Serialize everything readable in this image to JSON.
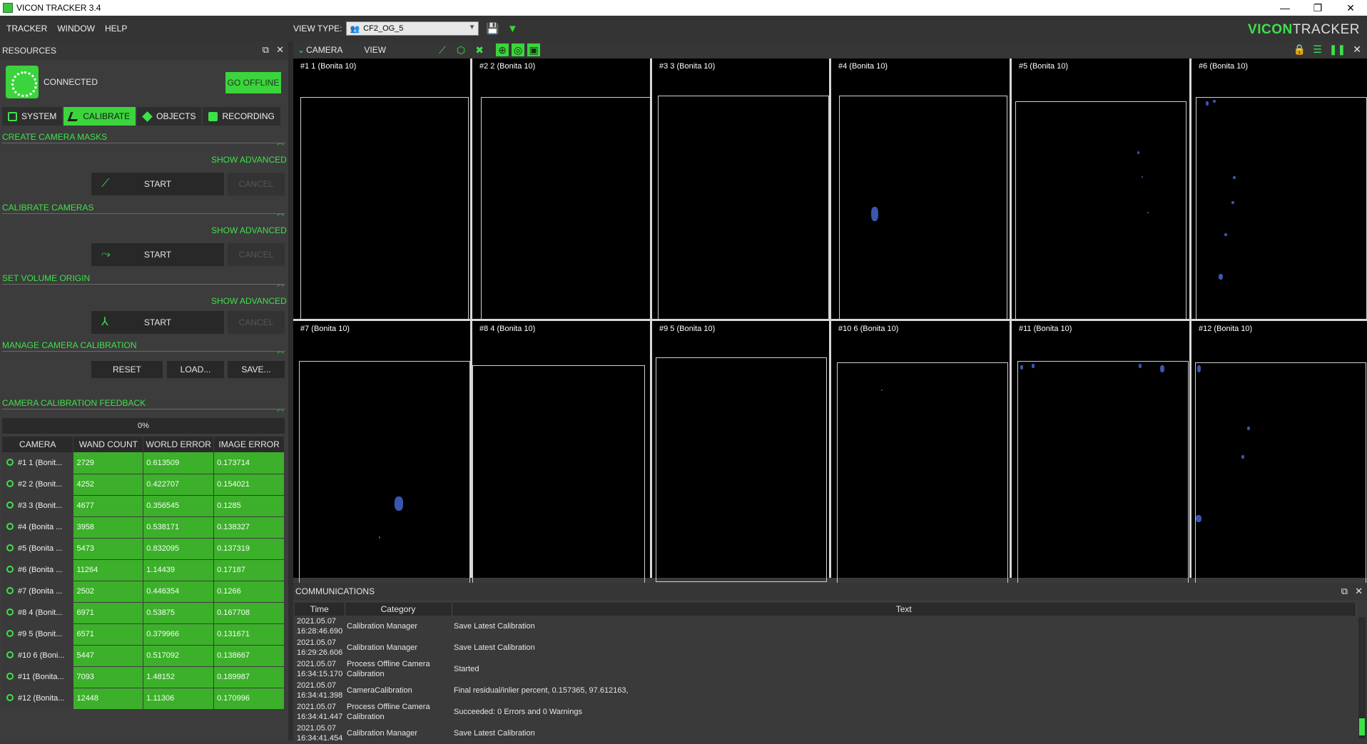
{
  "window": {
    "title": "VICON TRACKER 3.4",
    "min": "—",
    "restore": "❐",
    "close": "✕"
  },
  "menu": {
    "items": [
      "TRACKER",
      "WINDOW",
      "HELP"
    ]
  },
  "viewtype": {
    "label": "VIEW TYPE:",
    "value": "CF2_OG_5"
  },
  "brand": {
    "part1": "VICON",
    "part2": "TRACKER"
  },
  "resources": {
    "title": "RESOURCES",
    "status": "CONNECTED",
    "offline_button": "GO OFFLINE",
    "tabs": [
      {
        "label": "SYSTEM"
      },
      {
        "label": "CALIBRATE"
      },
      {
        "label": "OBJECTS"
      },
      {
        "label": "RECORDING"
      }
    ]
  },
  "calibrate": {
    "masks": {
      "title": "CREATE CAMERA MASKS",
      "advanced": "SHOW ADVANCED",
      "start": "START",
      "cancel": "CANCEL"
    },
    "cameras": {
      "title": "CALIBRATE CAMERAS",
      "advanced": "SHOW ADVANCED",
      "start": "START",
      "cancel": "CANCEL"
    },
    "origin": {
      "title": "SET VOLUME ORIGIN",
      "advanced": "SHOW ADVANCED",
      "start": "START",
      "cancel": "CANCEL"
    },
    "manage": {
      "title": "MANAGE CAMERA CALIBRATION",
      "reset": "RESET",
      "load": "LOAD...",
      "save": "SAVE..."
    },
    "feedback": {
      "title": "CAMERA CALIBRATION FEEDBACK",
      "progress": "0%",
      "columns": [
        "CAMERA",
        "WAND COUNT",
        "WORLD ERROR",
        "IMAGE ERROR"
      ],
      "rows": [
        {
          "camera": "#1 1 (Bonit...",
          "wand": "2729",
          "world": "0.613509",
          "image": "0.173714"
        },
        {
          "camera": "#2 2 (Bonit...",
          "wand": "4252",
          "world": "0.422707",
          "image": "0.154021"
        },
        {
          "camera": "#3 3 (Bonit...",
          "wand": "4677",
          "world": "0.356545",
          "image": "0.1285"
        },
        {
          "camera": "#4 (Bonita ...",
          "wand": "3958",
          "world": "0.538171",
          "image": "0.138327"
        },
        {
          "camera": "#5 (Bonita ...",
          "wand": "5473",
          "world": "0.832095",
          "image": "0.137319"
        },
        {
          "camera": "#6 (Bonita ...",
          "wand": "11264",
          "world": "1.14439",
          "image": "0.17187"
        },
        {
          "camera": "#7 (Bonita ...",
          "wand": "2502",
          "world": "0.446354",
          "image": "0.1266"
        },
        {
          "camera": "#8 4 (Bonit...",
          "wand": "6971",
          "world": "0.53875",
          "image": "0.167708"
        },
        {
          "camera": "#9 5 (Bonit...",
          "wand": "6571",
          "world": "0.379966",
          "image": "0.131671"
        },
        {
          "camera": "#10 6 (Boni...",
          "wand": "5447",
          "world": "0.517092",
          "image": "0.138667"
        },
        {
          "camera": "#11 (Bonita...",
          "wand": "7093",
          "world": "1.48152",
          "image": "0.189987"
        },
        {
          "camera": "#12 (Bonita...",
          "wand": "12448",
          "world": "1.11306",
          "image": "0.170996"
        }
      ]
    }
  },
  "camera_view": {
    "label": "CAMERA",
    "view_label": "VIEW",
    "cameras": [
      "#1 1 (Bonita 10)",
      "#2 2 (Bonita 10)",
      "#3 3 (Bonita 10)",
      "#4 (Bonita 10)",
      "#5 (Bonita 10)",
      "#6 (Bonita 10)",
      "#7 (Bonita 10)",
      "#8 4 (Bonita 10)",
      "#9 5 (Bonita 10)",
      "#10 6 (Bonita 10)",
      "#11 (Bonita 10)",
      "#12 (Bonita 10)"
    ]
  },
  "communications": {
    "title": "COMMUNICATIONS",
    "columns": [
      "Time",
      "Category",
      "Text"
    ],
    "rows": [
      {
        "time1": "2021.05.07",
        "time2": "16:28:46.690",
        "category": "Calibration Manager",
        "text": "Save Latest Calibration"
      },
      {
        "time1": "2021.05.07",
        "time2": "16:29:26.606",
        "category": "Calibration Manager",
        "text": "Save Latest Calibration"
      },
      {
        "time1": "2021.05.07",
        "time2": "16:34:15.170",
        "category": "Process Offline Camera Calibration",
        "text": "Started"
      },
      {
        "time1": "2021.05.07",
        "time2": "16:34:41.398",
        "category": "CameraCalibration",
        "text": "Final residual/inlier percent, 0.157365, 97.612163,"
      },
      {
        "time1": "2021.05.07",
        "time2": "16:34:41.447",
        "category": "Process Offline Camera Calibration",
        "text": "Succeeded: 0 Errors and 0 Warnings"
      },
      {
        "time1": "2021.05.07",
        "time2": "16:34:41.454",
        "category": "Calibration Manager",
        "text": "Save Latest Calibration"
      }
    ]
  },
  "colors": {
    "accent": "#3bd43c",
    "cell_green": "#3cb02a",
    "blob": "#3a56b0"
  }
}
